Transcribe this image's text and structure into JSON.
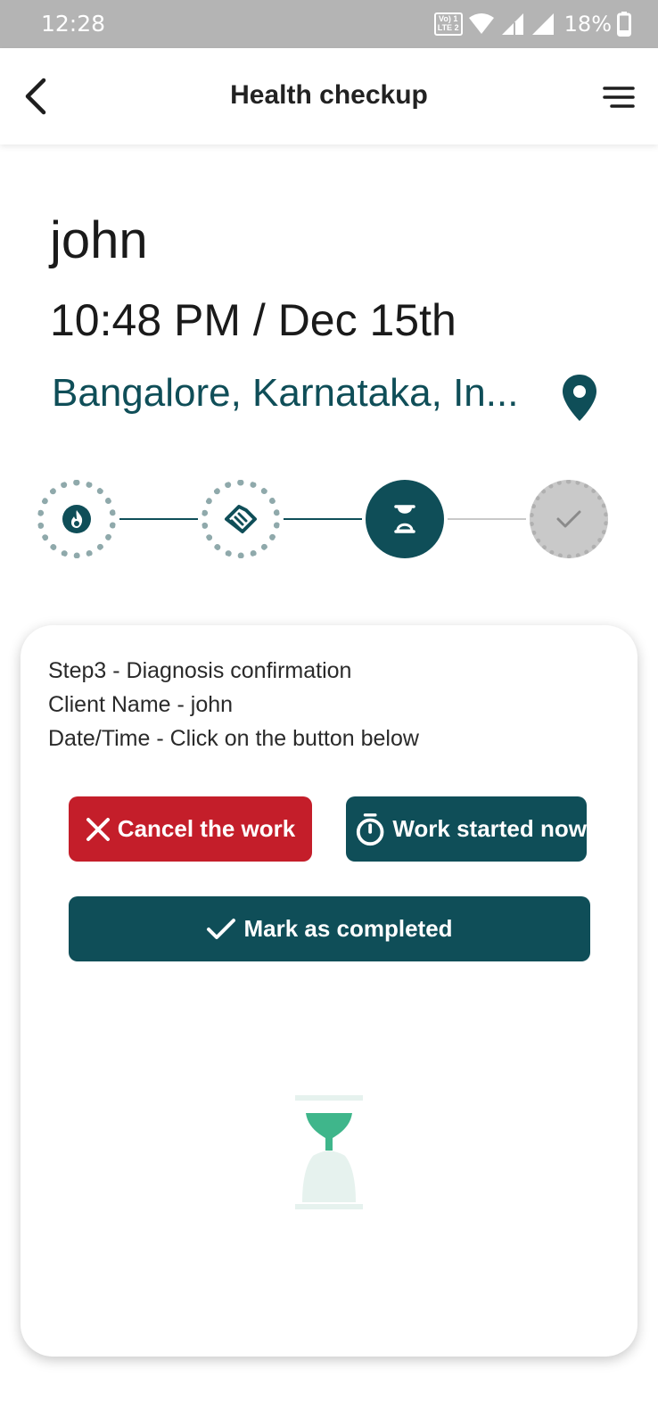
{
  "status_bar": {
    "time": "12:28",
    "network_badge_top": "Vo) 1",
    "network_badge_bottom": "LTE 2",
    "battery": "18%"
  },
  "header": {
    "title": "Health checkup",
    "back_icon": "chevron-left-icon",
    "menu_icon": "menu-icon"
  },
  "booking": {
    "client_name": "john",
    "datetime": "10:48 PM / Dec 15th",
    "location": "Bangalore, Karnataka, In...",
    "location_icon": "map-pin-icon"
  },
  "stepper": {
    "steps": [
      {
        "icon": "flame-icon",
        "state": "done"
      },
      {
        "icon": "handshake-icon",
        "state": "done"
      },
      {
        "icon": "hourglass-icon",
        "state": "active"
      },
      {
        "icon": "check-icon",
        "state": "pending"
      }
    ]
  },
  "card": {
    "step_line": "Step3  - Diagnosis confirmation",
    "client_line": "Client Name  - john",
    "datetime_line": "Date/Time  - Click on the button below",
    "cancel_label": "Cancel the work",
    "start_label": "Work started now",
    "complete_label": "Mark as completed"
  },
  "colors": {
    "primary": "#0f4e58",
    "danger": "#c41e2a",
    "accent_green": "#3fb68b",
    "status_bar": "#b4b4b4",
    "pending_gray": "#c9c9c9"
  }
}
